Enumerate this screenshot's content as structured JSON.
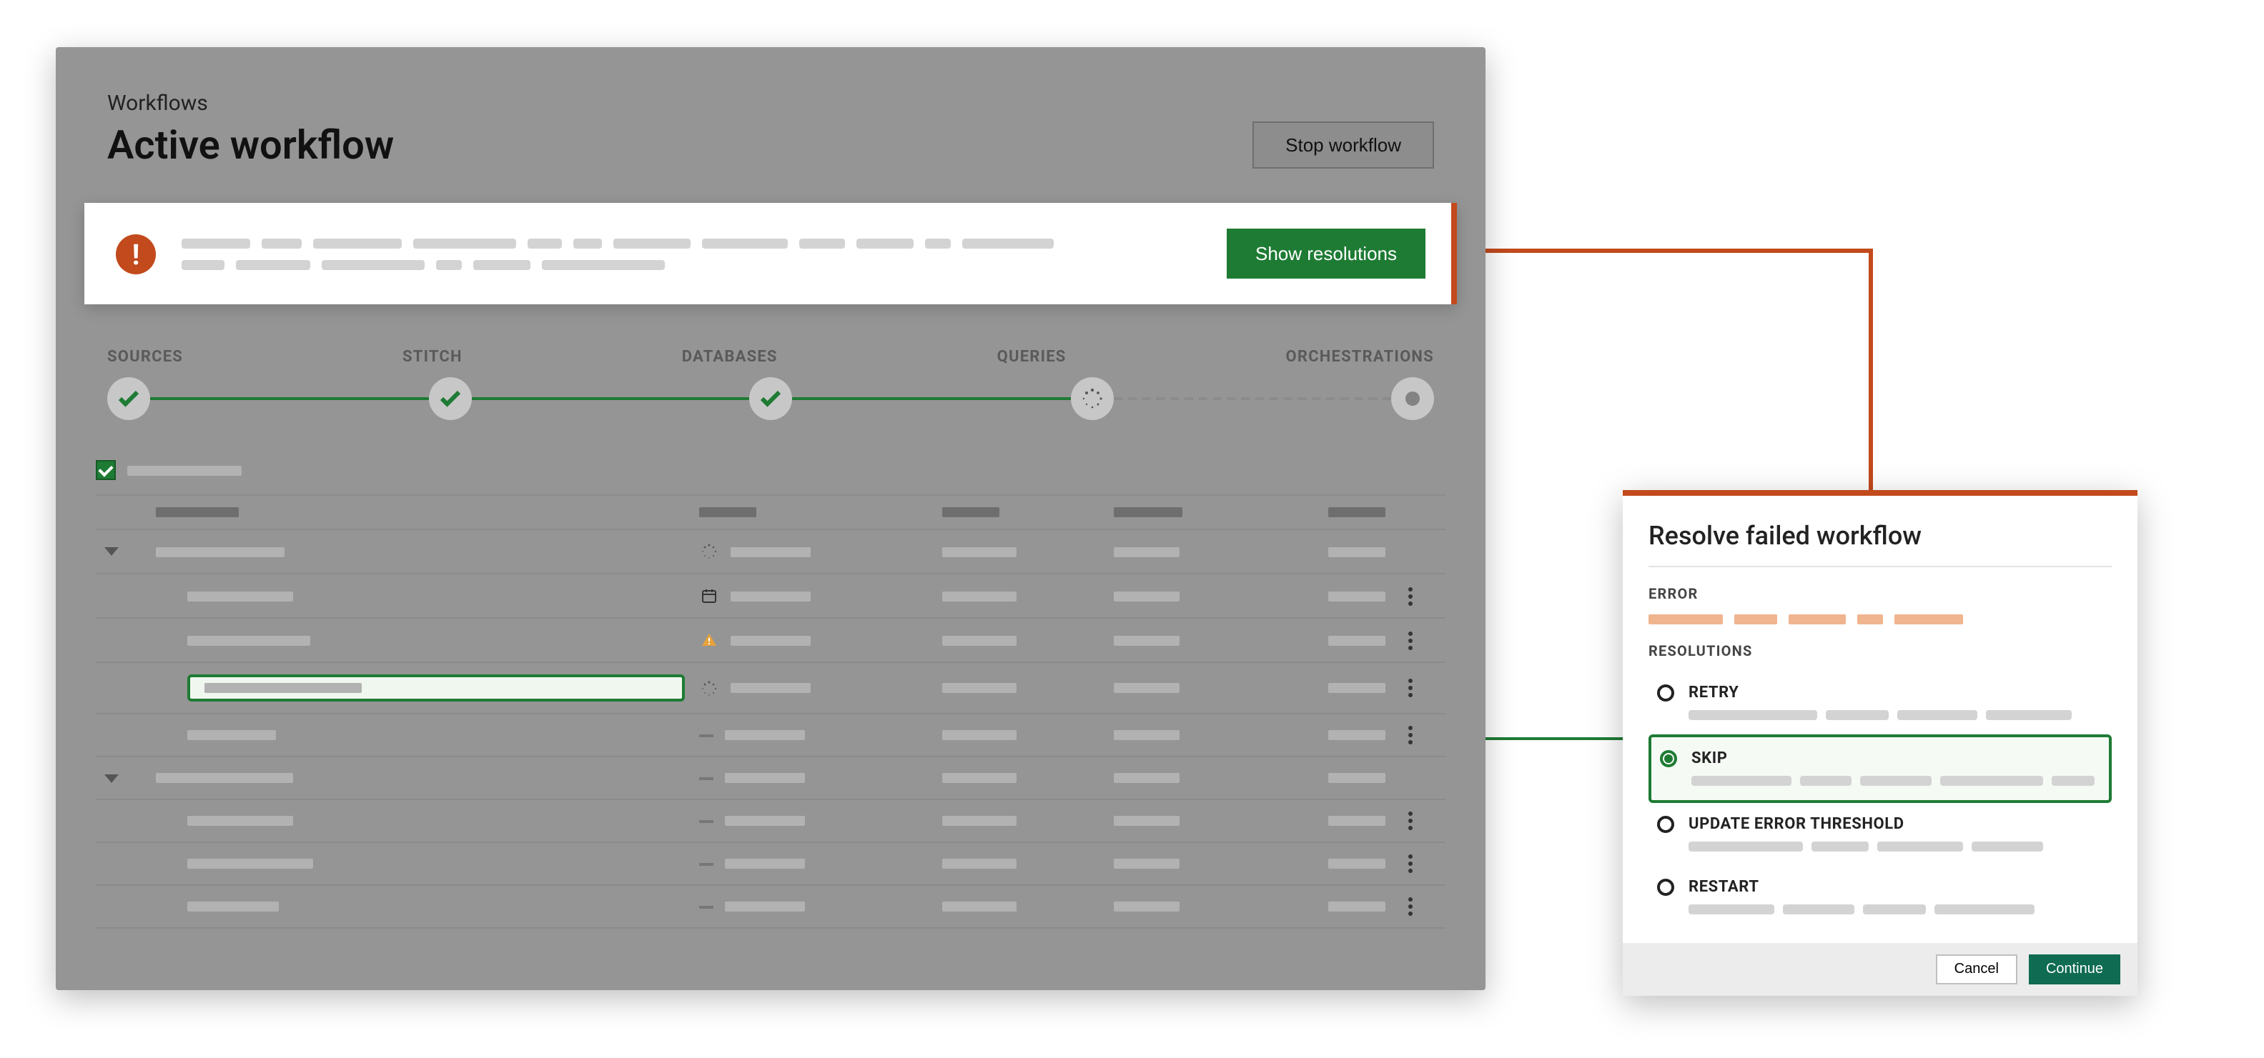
{
  "header": {
    "eyebrow": "Workflows",
    "title": "Active workflow",
    "stop_label": "Stop workflow"
  },
  "alert": {
    "icon": "alert-icon",
    "button_label": "Show resolutions"
  },
  "stepper": {
    "labels": [
      "SOURCES",
      "STITCH",
      "DATABASES",
      "QUERIES",
      "ORCHESTRATIONS"
    ],
    "states": [
      "done",
      "done",
      "done",
      "loading",
      "idle"
    ]
  },
  "dialog": {
    "title": "Resolve failed workflow",
    "error_label": "ERROR",
    "resolutions_label": "RESOLUTIONS",
    "options": [
      {
        "key": "retry",
        "label": "RETRY",
        "selected": false
      },
      {
        "key": "skip",
        "label": "SKIP",
        "selected": true
      },
      {
        "key": "update",
        "label": "UPDATE ERROR THRESHOLD",
        "selected": false
      },
      {
        "key": "restart",
        "label": "RESTART",
        "selected": false
      }
    ],
    "cancel_label": "Cancel",
    "continue_label": "Continue"
  },
  "colors": {
    "accent_orange": "#C24A1C",
    "accent_green": "#1E7B34",
    "accent_teal": "#0F6B52"
  }
}
